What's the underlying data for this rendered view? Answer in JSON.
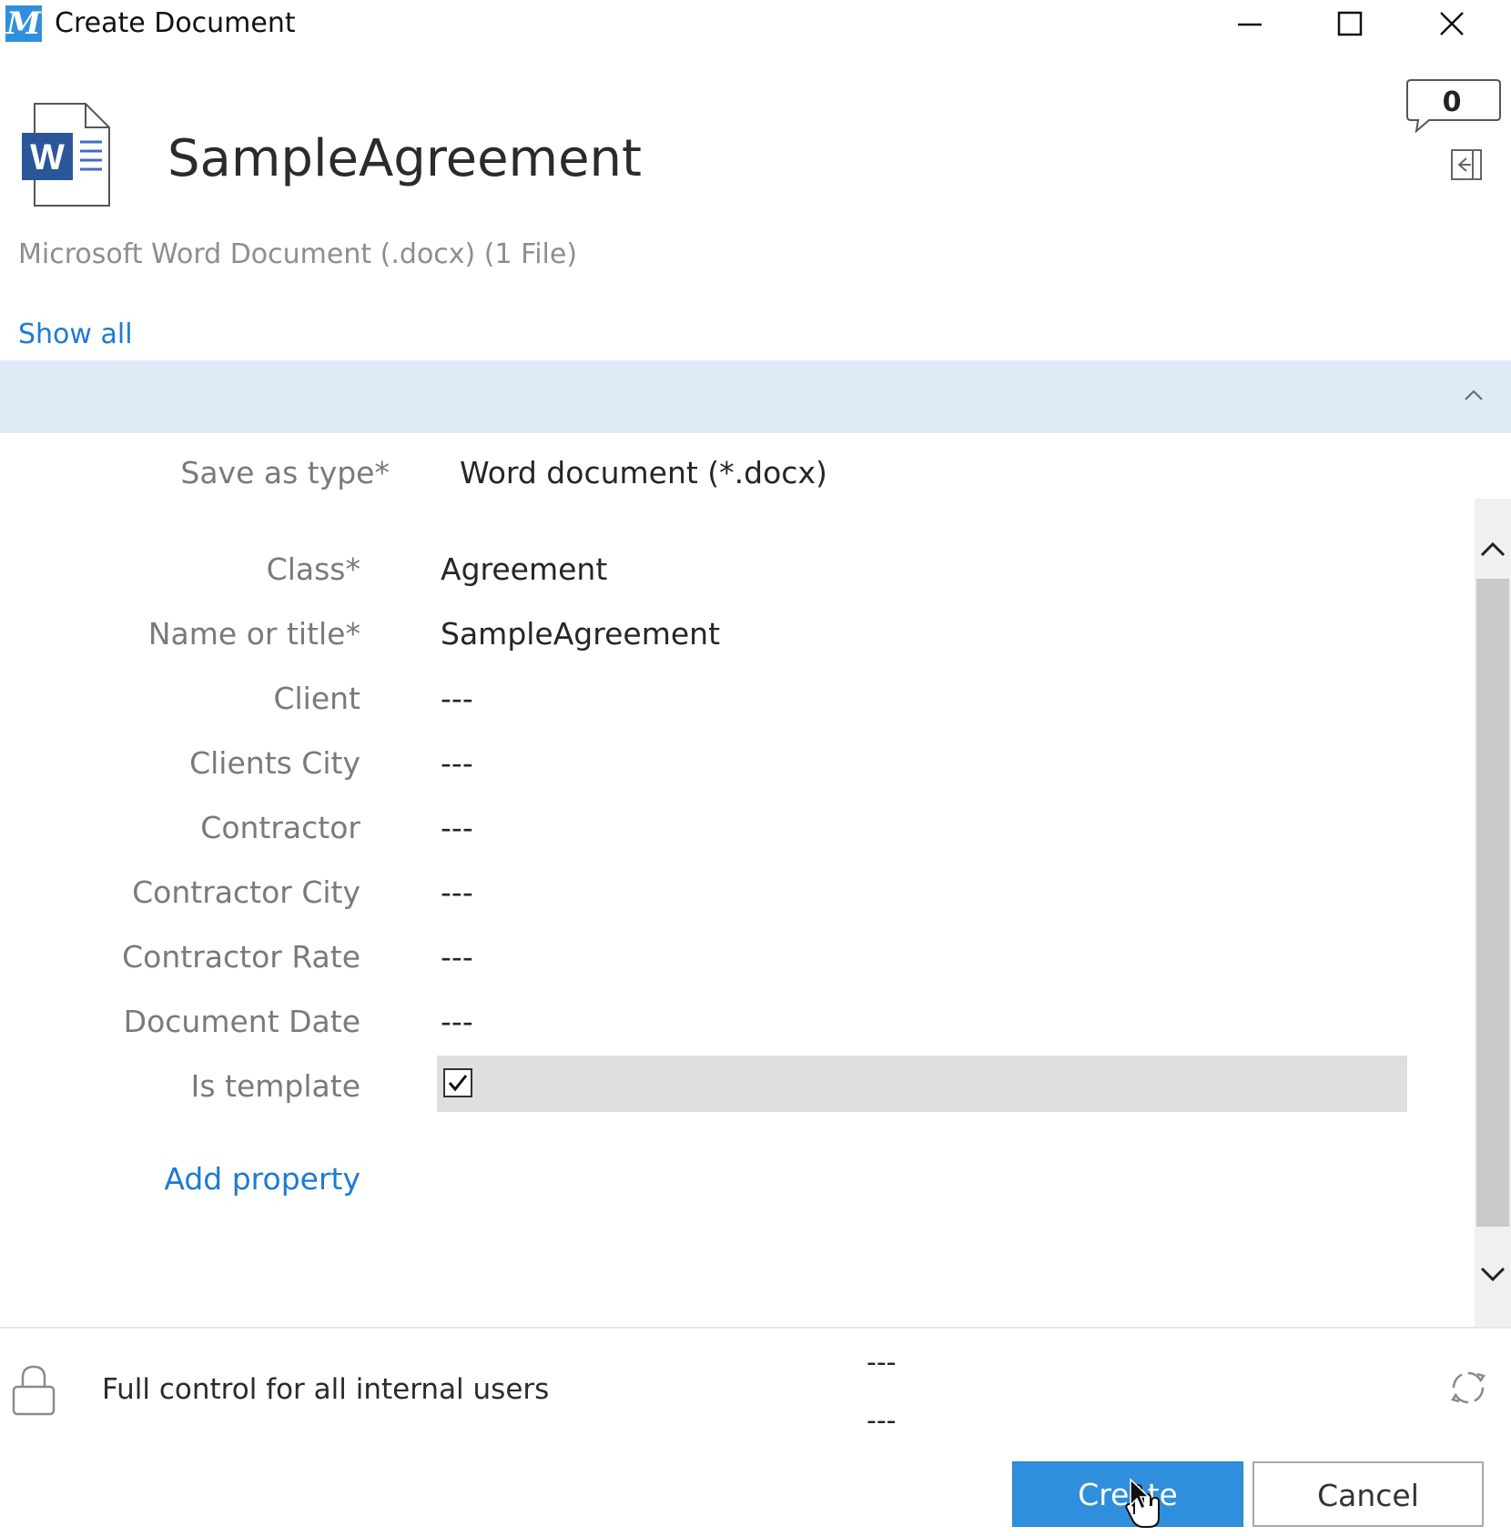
{
  "window": {
    "title": "Create Document",
    "app_logo_letter": "M"
  },
  "header": {
    "document_title": "SampleAgreement",
    "subtitle": "Microsoft Word Document (.docx) (1 File)",
    "show_all_label": "Show all",
    "comment_count": "0",
    "file_icon_letter": "W"
  },
  "save_as": {
    "label": "Save as type*",
    "value": "Word document (*.docx)"
  },
  "properties": [
    {
      "label": "Class*",
      "value": "Agreement"
    },
    {
      "label": "Name or title*",
      "value": "SampleAgreement"
    },
    {
      "label": "Client",
      "value": "---"
    },
    {
      "label": "Clients City",
      "value": "---"
    },
    {
      "label": "Contractor",
      "value": "---"
    },
    {
      "label": "Contractor City",
      "value": "---"
    },
    {
      "label": "Contractor Rate",
      "value": "---"
    },
    {
      "label": "Document Date",
      "value": "---"
    },
    {
      "label": "Is template",
      "value": true
    }
  ],
  "add_property_label": "Add property",
  "footer": {
    "permission": "Full control for all internal users",
    "workflow_line1": "---",
    "workflow_line2": "---"
  },
  "buttons": {
    "create": "Create",
    "cancel": "Cancel"
  },
  "colors": {
    "accent": "#2f8fdc",
    "link": "#1e7ad6",
    "band": "#deebf7"
  }
}
